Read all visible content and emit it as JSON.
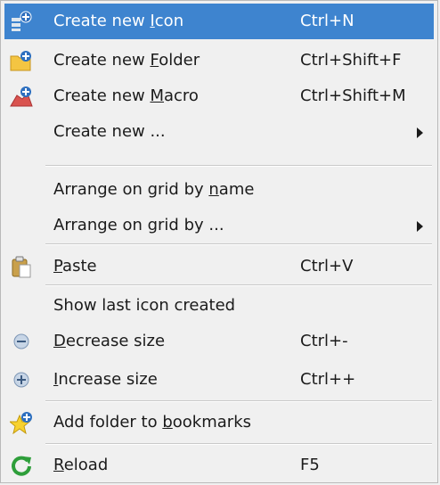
{
  "menu": {
    "items": [
      {
        "pre": "Create new ",
        "acc": "I",
        "post": "con",
        "shortcut": "Ctrl+N",
        "icon": "new-icon-icon"
      },
      {
        "pre": "Create new ",
        "acc": "F",
        "post": "older",
        "shortcut": "Ctrl+Shift+F",
        "icon": "new-folder-icon"
      },
      {
        "pre": "Create new ",
        "acc": "M",
        "post": "acro",
        "shortcut": "Ctrl+Shift+M",
        "icon": "new-macro-icon"
      },
      {
        "pre": "Create new ...",
        "acc": "",
        "post": "",
        "shortcut": "",
        "icon": ""
      },
      {
        "pre": "Arrange on grid by ",
        "acc": "n",
        "post": "ame",
        "shortcut": "",
        "icon": ""
      },
      {
        "pre": "Arrange on grid by ...",
        "acc": "",
        "post": "",
        "shortcut": "",
        "icon": ""
      },
      {
        "pre": "",
        "acc": "P",
        "post": "aste",
        "shortcut": "Ctrl+V",
        "icon": "paste-icon"
      },
      {
        "pre": "Show last icon created",
        "acc": "",
        "post": "",
        "shortcut": "",
        "icon": ""
      },
      {
        "pre": "",
        "acc": "D",
        "post": "ecrease size",
        "shortcut": "Ctrl+-",
        "icon": "zoom-out-icon"
      },
      {
        "pre": "",
        "acc": "I",
        "post": "ncrease size",
        "shortcut": "Ctrl++",
        "icon": "zoom-in-icon"
      },
      {
        "pre": "Add folder to ",
        "acc": "b",
        "post": "ookmarks",
        "shortcut": "",
        "icon": "bookmark-add-icon"
      },
      {
        "pre": "",
        "acc": "R",
        "post": "eload",
        "shortcut": "F5",
        "icon": "reload-icon"
      }
    ]
  }
}
